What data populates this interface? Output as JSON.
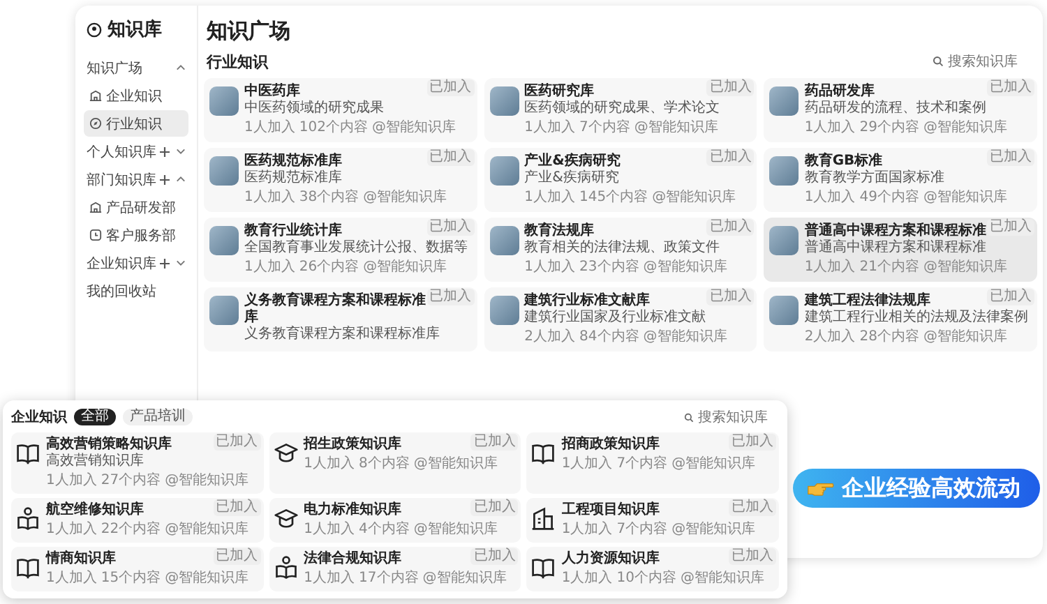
{
  "sidebar": {
    "logo": "知识库",
    "sections": [
      {
        "label": "知识广场",
        "kind": "group",
        "expanded": true,
        "addable": false,
        "children": [
          {
            "label": "企业知识",
            "kind": "building",
            "selected": false
          },
          {
            "label": "行业知识",
            "kind": "compass",
            "selected": true
          }
        ]
      },
      {
        "label": "个人知识库",
        "kind": "group",
        "expanded": false,
        "addable": true
      },
      {
        "label": "部门知识库",
        "kind": "group",
        "expanded": true,
        "addable": true,
        "children": [
          {
            "label": "产品研发部",
            "kind": "building",
            "selected": false
          },
          {
            "label": "客户服务部",
            "kind": "clock",
            "selected": false
          }
        ]
      },
      {
        "label": "企业知识库",
        "kind": "group",
        "expanded": false,
        "addable": true
      },
      {
        "label": "我的回收站",
        "kind": "link"
      }
    ]
  },
  "main": {
    "title": "知识广场",
    "section": "行业知识",
    "search": {
      "placeholder": "搜索知识库"
    },
    "cards": [
      {
        "title": "中医药库",
        "description": "中医药领域的研究成果",
        "badge": "已加入",
        "meta": [
          "1人加入",
          "102个内容",
          "@智能知识库"
        ],
        "selected": false
      },
      {
        "title": "医药研究库",
        "description": "医药领域的研究成果、学术论文",
        "badge": "已加入",
        "meta": [
          "1人加入",
          "7个内容",
          "@智能知识库"
        ],
        "selected": false
      },
      {
        "title": "药品研发库",
        "description": "药品研发的流程、技术和案例",
        "badge": "已加入",
        "meta": [
          "1人加入",
          "29个内容",
          "@智能知识库"
        ],
        "selected": false
      },
      {
        "title": "医药规范标准库",
        "description": "医药规范标准库",
        "badge": "已加入",
        "meta": [
          "1人加入",
          "38个内容",
          "@智能知识库"
        ],
        "selected": false
      },
      {
        "title": "产业&疾病研究",
        "description": "产业&疾病研究",
        "badge": "已加入",
        "meta": [
          "1人加入",
          "145个内容",
          "@智能知识库"
        ],
        "selected": false
      },
      {
        "title": "教育GB标准",
        "description": "教育教学方面国家标准",
        "badge": "已加入",
        "meta": [
          "1人加入",
          "49个内容",
          "@智能知识库"
        ],
        "selected": false
      },
      {
        "title": "教育行业统计库",
        "description": "全国教育事业发展统计公报、数据等",
        "badge": "已加入",
        "meta": [
          "1人加入",
          "26个内容",
          "@智能知识库"
        ],
        "selected": false
      },
      {
        "title": "教育法规库",
        "description": "教育相关的法律法规、政策文件",
        "badge": "已加入",
        "meta": [
          "1人加入",
          "23个内容",
          "@智能知识库"
        ],
        "selected": false
      },
      {
        "title": "普通高中课程方案和课程标准",
        "description": "普通高中课程方案和课程标准",
        "badge": "已加入",
        "meta": [
          "1人加入",
          "21个内容",
          "@智能知识库"
        ],
        "selected": true
      },
      {
        "title": "义务教育课程方案和课程标准库",
        "description": "义务教育课程方案和课程标准库",
        "badge": "已加入",
        "selected": false
      },
      {
        "title": "建筑行业标准文献库",
        "description": "建筑行业国家及行业标准文献",
        "badge": "已加入",
        "meta": [
          "2人加入",
          "84个内容",
          "@智能知识库"
        ],
        "selected": false
      },
      {
        "title": "建筑工程法律法规库",
        "description": "建筑工程行业相关的法规及法律案例",
        "badge": "已加入",
        "meta": [
          "2人加入",
          "28个内容",
          "@智能知识库"
        ],
        "selected": false
      }
    ]
  },
  "overlay": {
    "title": "企业知识",
    "tabs": [
      {
        "label": "全部",
        "selected": true
      },
      {
        "label": "产品培训",
        "selected": false
      }
    ],
    "search": {
      "placeholder": "搜索知识库"
    },
    "cards": [
      {
        "kind": "book",
        "title": "高效营销策略知识库",
        "description": "高效营销知识库",
        "badge": "已加入",
        "meta": [
          "1人加入",
          "27个内容",
          "@智能知识库"
        ]
      },
      {
        "kind": "cap",
        "title": "招生政策知识库",
        "badge": "已加入",
        "meta": [
          "1人加入",
          "8个内容",
          "@智能知识库"
        ]
      },
      {
        "kind": "book",
        "title": "招商政策知识库",
        "badge": "已加入",
        "meta": [
          "1人加入",
          "7个内容",
          "@智能知识库"
        ]
      },
      {
        "kind": "reader",
        "title": "航空维修知识库",
        "badge": "已加入",
        "meta": [
          "1人加入",
          "22个内容",
          "@智能知识库"
        ]
      },
      {
        "kind": "cap",
        "title": "电力标准知识库",
        "badge": "已加入",
        "meta": [
          "1人加入",
          "4个内容",
          "@智能知识库"
        ]
      },
      {
        "kind": "building",
        "title": "工程项目知识库",
        "badge": "已加入",
        "meta": [
          "1人加入",
          "7个内容",
          "@智能知识库"
        ]
      },
      {
        "kind": "book",
        "title": "情商知识库",
        "badge": "已加入",
        "meta": [
          "1人加入",
          "15个内容",
          "@智能知识库"
        ]
      },
      {
        "kind": "reader",
        "title": "法律合规知识库",
        "badge": "已加入",
        "meta": [
          "1人加入",
          "17个内容",
          "@智能知识库"
        ]
      },
      {
        "kind": "book",
        "title": "人力资源知识库",
        "badge": "已加入",
        "meta": [
          "1人加入",
          "10个内容",
          "@智能知识库"
        ]
      }
    ]
  },
  "slogan": "企业经验高效流动"
}
